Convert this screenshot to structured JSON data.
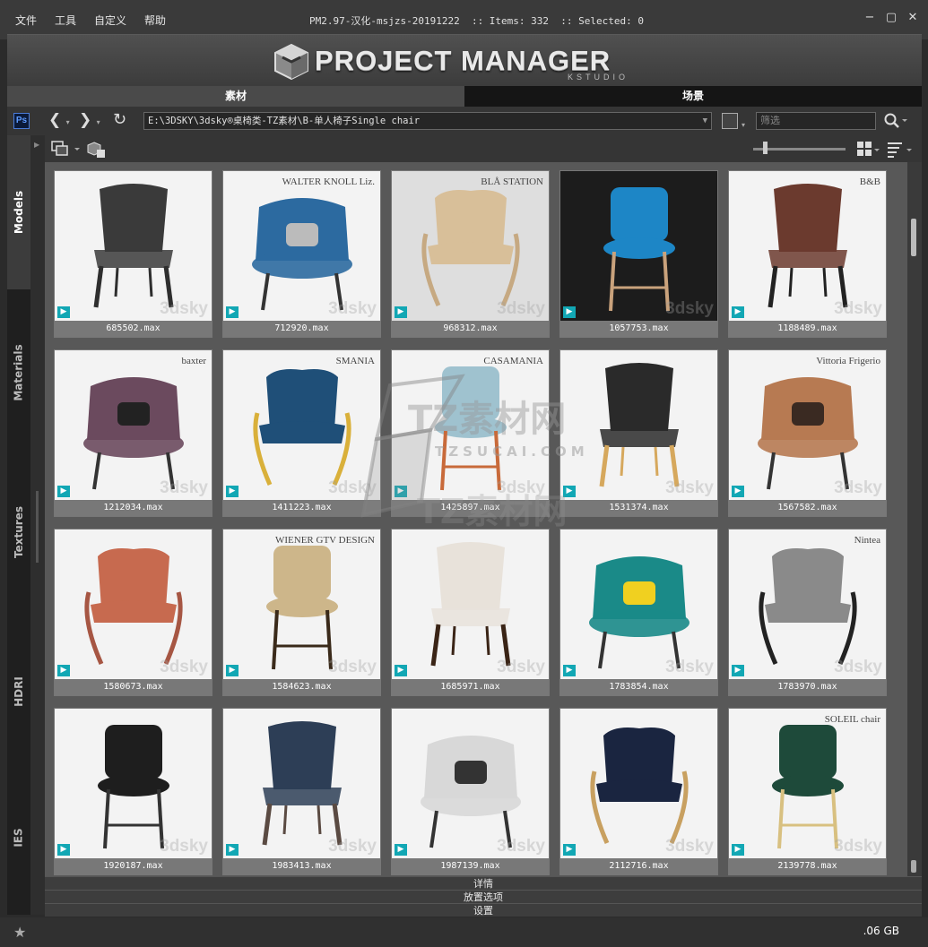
{
  "menu": [
    "文件",
    "工具",
    "自定义",
    "帮助"
  ],
  "title_info": "PM2.97-汉化-msjzs-20191222  :: Items: 332  :: Selected: 0",
  "window_buttons": {
    "minimize": "−",
    "maximize": "▢",
    "close": "✕"
  },
  "logo": {
    "main": "PROJECT MANAGER",
    "sub": "KSTUDIO"
  },
  "tabs": [
    {
      "label": "素材",
      "active": true
    },
    {
      "label": "场景",
      "active": false
    }
  ],
  "pathbar": {
    "ps_label": "Ps",
    "path": "E:\\3DSKY\\3dsky®桌椅类-TZ素材\\B-单人椅子Single chair",
    "filter_placeholder": "筛选"
  },
  "sidebar": [
    {
      "label": "Models",
      "active": true
    },
    {
      "label": "Materials",
      "active": false
    },
    {
      "label": "Textures",
      "active": false
    },
    {
      "label": "HDRI",
      "active": false
    },
    {
      "label": "IES",
      "active": false
    }
  ],
  "watermark_text": "3dsky",
  "items": [
    {
      "name": "685502.max",
      "brand": "",
      "bg": "light",
      "seat": "#3a3a3a",
      "accent": "#2e2e2e"
    },
    {
      "name": "712920.max",
      "brand": "WALTER KNOLL  Liz.",
      "bg": "light",
      "seat": "#2c6aa0",
      "accent": "#bbb"
    },
    {
      "name": "968312.max",
      "brand": "BLÅ STATION",
      "bg": "grey",
      "seat": "#d8bf99",
      "accent": "#c6a982"
    },
    {
      "name": "1057753.max",
      "brand": "",
      "bg": "dark",
      "seat": "#1d86c6",
      "accent": "#c9a27c"
    },
    {
      "name": "1188489.max",
      "brand": "B&B",
      "bg": "light",
      "seat": "#6b3a2e",
      "accent": "#222"
    },
    {
      "name": "1212034.max",
      "brand": "baxter",
      "bg": "light",
      "seat": "#6b4a5e",
      "accent": "#222"
    },
    {
      "name": "1411223.max",
      "brand": "SMANIA",
      "bg": "light",
      "seat": "#1f4f78",
      "accent": "#d9b03a"
    },
    {
      "name": "1425897.max",
      "brand": "CASAMANIA",
      "bg": "light",
      "seat": "#9fc2cf",
      "accent": "#c86a3a"
    },
    {
      "name": "1531374.max",
      "brand": "",
      "bg": "light",
      "seat": "#2a2a2a",
      "accent": "#d6a85d"
    },
    {
      "name": "1567582.max",
      "brand": "Vittoria Frigerio",
      "bg": "light",
      "seat": "#b77a52",
      "accent": "#3a2a22"
    },
    {
      "name": "1580673.max",
      "brand": "",
      "bg": "light",
      "seat": "#c76a4f",
      "accent": "#a65643"
    },
    {
      "name": "1584623.max",
      "brand": "WIENER GTV DESIGN",
      "bg": "light",
      "seat": "#cdb68a",
      "accent": "#3a2a1a"
    },
    {
      "name": "1685971.max",
      "brand": "",
      "bg": "light",
      "seat": "#e8e2da",
      "accent": "#3a2416"
    },
    {
      "name": "1783854.max",
      "brand": "",
      "bg": "light",
      "seat": "#1a8a88",
      "accent": "#f0d020"
    },
    {
      "name": "1783970.max",
      "brand": "Nintea",
      "bg": "light",
      "seat": "#8a8a8a",
      "accent": "#222"
    },
    {
      "name": "1920187.max",
      "brand": "",
      "bg": "light",
      "seat": "#1e1e1e",
      "accent": "#333"
    },
    {
      "name": "1983413.max",
      "brand": "",
      "bg": "light",
      "seat": "#2d3e56",
      "accent": "#5a4a42"
    },
    {
      "name": "1987139.max",
      "brand": "",
      "bg": "light",
      "seat": "#d8d8d8",
      "accent": "#333"
    },
    {
      "name": "2112716.max",
      "brand": "",
      "bg": "light",
      "seat": "#1a2540",
      "accent": "#c8a060"
    },
    {
      "name": "2139778.max",
      "brand": "SOLEIL chair",
      "bg": "light",
      "seat": "#1e4a3a",
      "accent": "#d8c080"
    }
  ],
  "overlay_watermark": {
    "line1": "TZ素材网",
    "line2": "TZSUCAI.COM",
    "line3": "TZ素材网"
  },
  "panels": [
    "详情",
    "放置选项",
    "设置"
  ],
  "status": {
    "size": ".06 GB",
    "star": "★"
  }
}
